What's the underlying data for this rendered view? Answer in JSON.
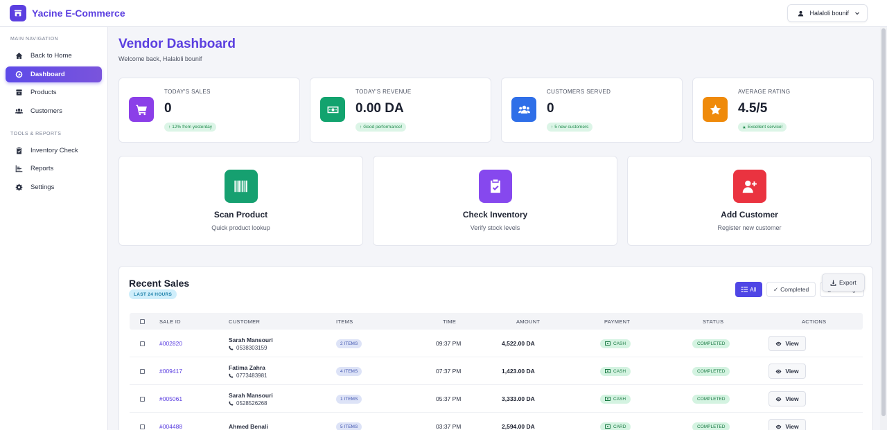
{
  "header": {
    "brand": "Yacine E-Commerce",
    "brand_icon": "store-icon",
    "user_name": "Halaloli bounif"
  },
  "sidebar": {
    "sections": [
      {
        "title": "MAIN NAVIGATION",
        "items": [
          {
            "label": "Back to Home",
            "icon": "home-icon"
          },
          {
            "label": "Dashboard",
            "icon": "gauge-icon",
            "active": true
          },
          {
            "label": "Products",
            "icon": "box-icon"
          },
          {
            "label": "Customers",
            "icon": "users-icon"
          }
        ]
      },
      {
        "title": "TOOLS & REPORTS",
        "items": [
          {
            "label": "Inventory Check",
            "icon": "clipboard-check-icon"
          },
          {
            "label": "Reports",
            "icon": "bar-chart-icon"
          },
          {
            "label": "Settings",
            "icon": "gear-icon"
          }
        ]
      }
    ]
  },
  "page": {
    "title": "Vendor Dashboard",
    "subtitle": "Welcome back, Halaloli bounif"
  },
  "stats": [
    {
      "label": "TODAY'S SALES",
      "value": "0",
      "note": "12% from yesterday",
      "note_icon": "arrow-up-icon",
      "icon": "cart-icon",
      "color": "#8b3fe8"
    },
    {
      "label": "TODAY'S REVENUE",
      "value": "0.00 DA",
      "note": "Good performance!",
      "note_icon": "arrow-up-icon",
      "icon": "money-icon",
      "color": "#12a36e"
    },
    {
      "label": "CUSTOMERS SERVED",
      "value": "0",
      "note": "5 new customers",
      "note_icon": "arrow-up-icon",
      "icon": "users-icon",
      "color": "#2f6fe8"
    },
    {
      "label": "AVERAGE RATING",
      "value": "4.5/5",
      "note": "Excellent service!",
      "note_icon": "star-icon",
      "icon": "star-icon",
      "color": "#ef8a0a"
    }
  ],
  "quick_actions": [
    {
      "title": "Scan Product",
      "subtitle": "Quick product lookup",
      "icon": "barcode-icon",
      "color": "#16a070"
    },
    {
      "title": "Check Inventory",
      "subtitle": "Verify stock levels",
      "icon": "clipboard-check-icon",
      "color": "#8648ee"
    },
    {
      "title": "Add Customer",
      "subtitle": "Register new customer",
      "icon": "user-plus-icon",
      "color": "#ea3340"
    }
  ],
  "recent_sales": {
    "title": "Recent Sales",
    "badge": "LAST 24 HOURS",
    "filters": {
      "all": "All",
      "completed": "Completed",
      "pending": "Pending"
    },
    "export_label": "Export",
    "columns": [
      "SALE ID",
      "CUSTOMER",
      "ITEMS",
      "TIME",
      "AMOUNT",
      "PAYMENT",
      "STATUS",
      "ACTIONS"
    ],
    "rows": [
      {
        "id": "#002820",
        "customer": "Sarah Mansouri",
        "phone": "0538303159",
        "items": "2 ITEMS",
        "time": "09:37 PM",
        "amount": "4,522.00 DA",
        "payment": "CASH",
        "status": "COMPLETED",
        "action": "View"
      },
      {
        "id": "#009417",
        "customer": "Fatima Zahra",
        "phone": "0773483981",
        "items": "4 ITEMS",
        "time": "07:37 PM",
        "amount": "1,423.00 DA",
        "payment": "CASH",
        "status": "COMPLETED",
        "action": "View"
      },
      {
        "id": "#005061",
        "customer": "Sarah Mansouri",
        "phone": "0528526268",
        "items": "1 ITEMS",
        "time": "05:37 PM",
        "amount": "3,333.00 DA",
        "payment": "CASH",
        "status": "COMPLETED",
        "action": "View"
      },
      {
        "id": "#004488",
        "customer": "Ahmed Benali",
        "phone": "",
        "items": "5 ITEMS",
        "time": "03:37 PM",
        "amount": "2,594.00 DA",
        "payment": "CARD",
        "status": "COMPLETED",
        "action": "View"
      }
    ]
  }
}
